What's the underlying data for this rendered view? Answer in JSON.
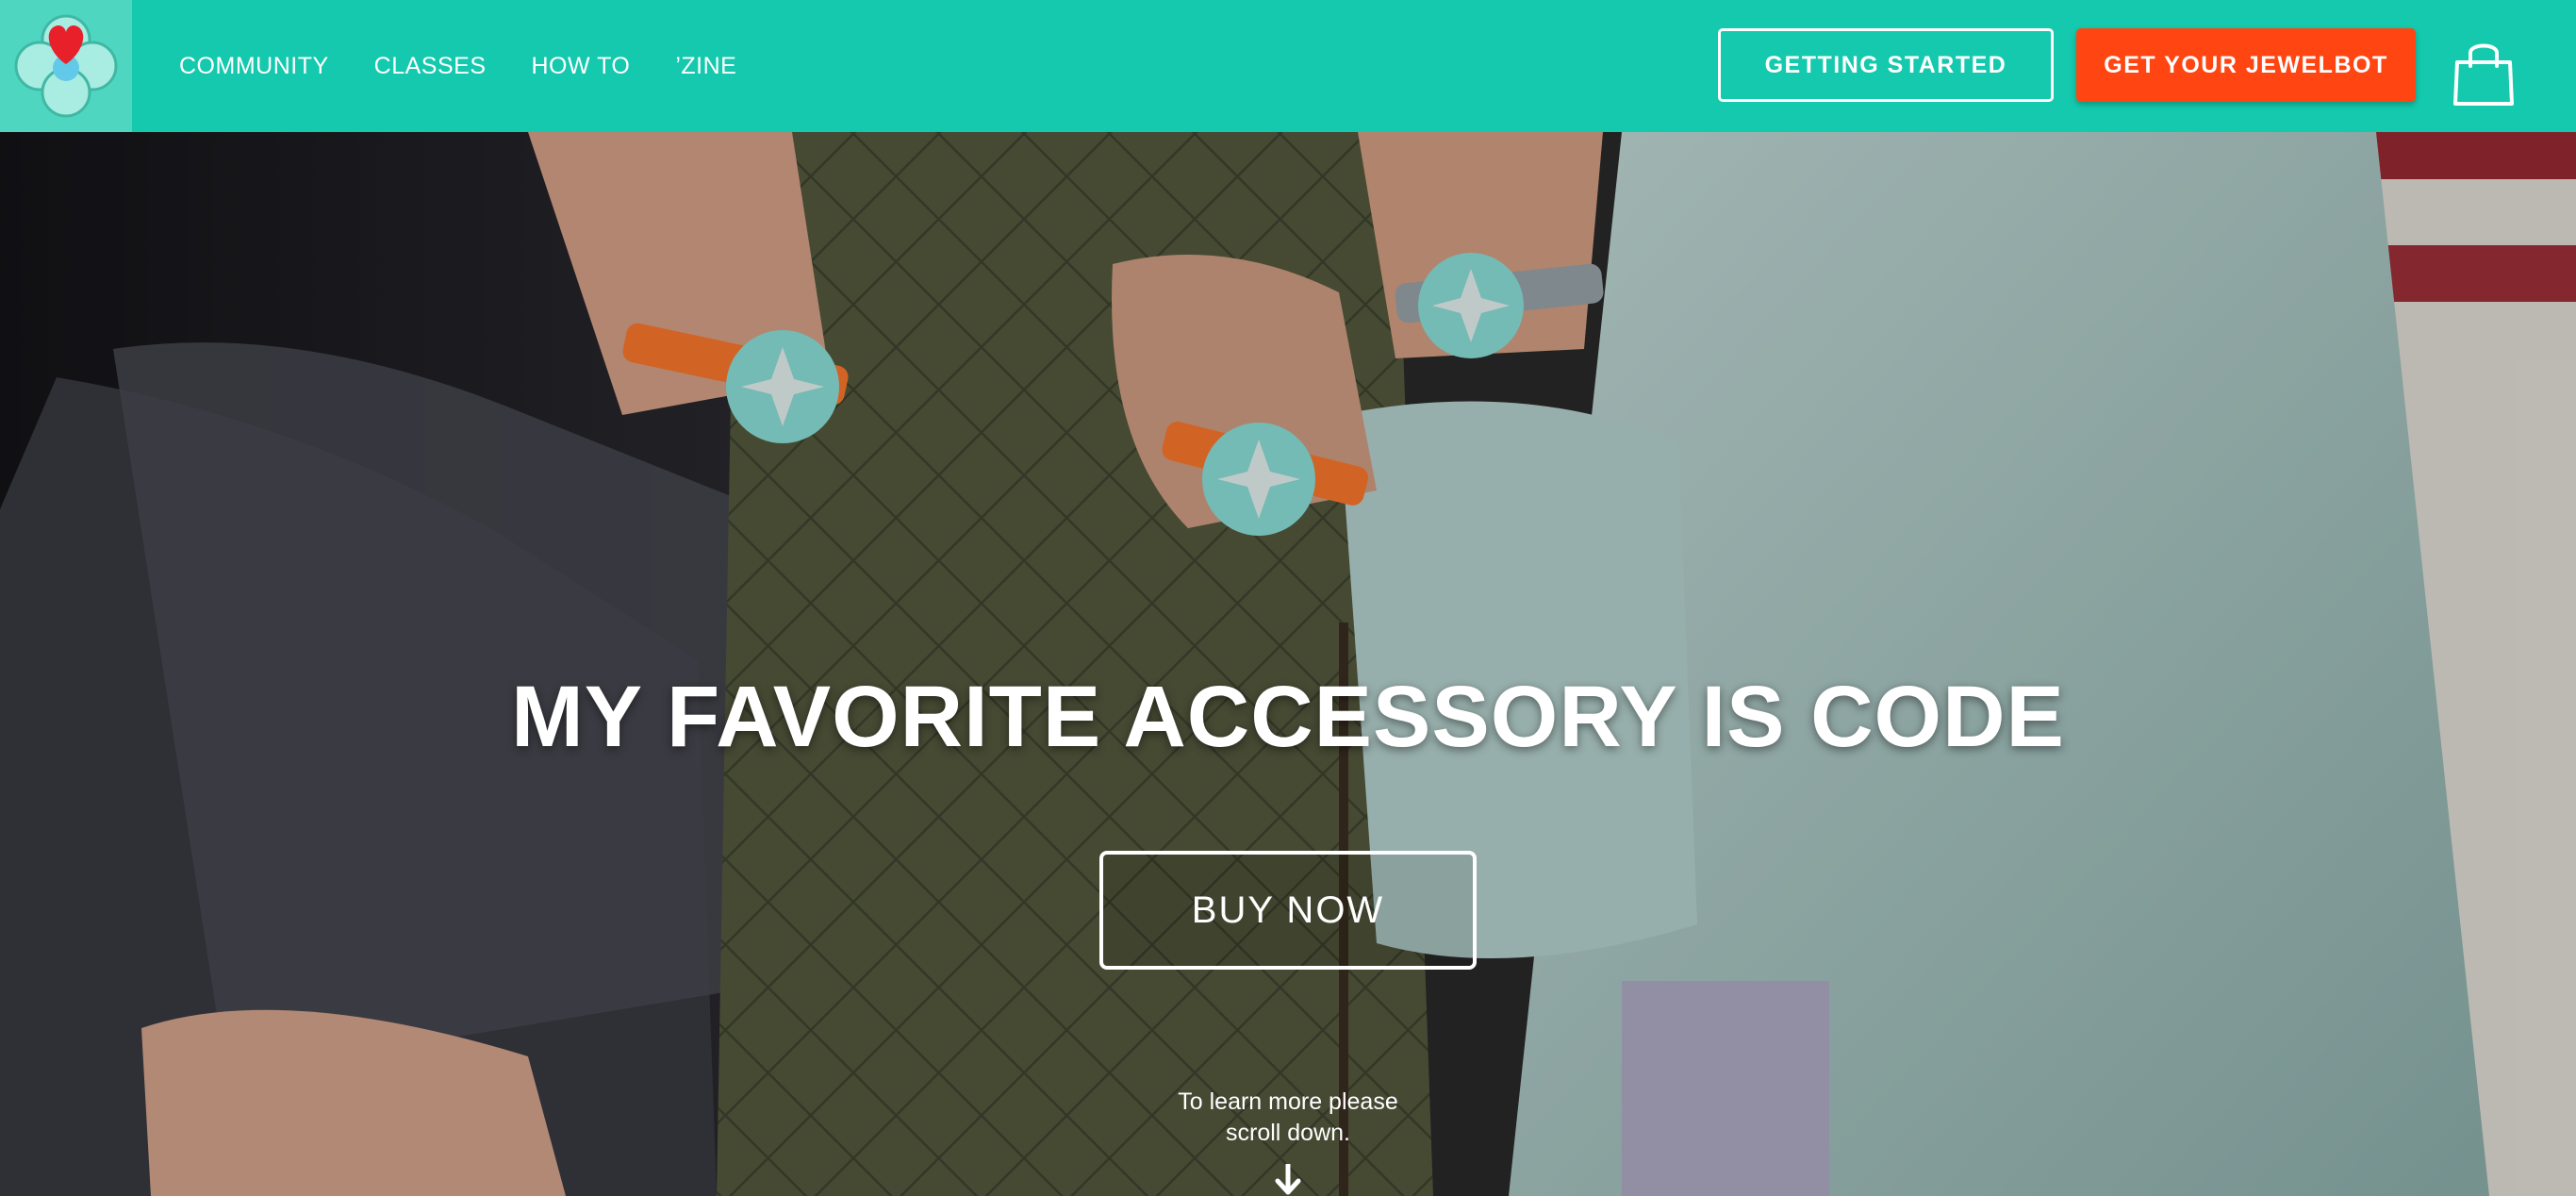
{
  "nav": {
    "links": [
      {
        "label": "COMMUNITY"
      },
      {
        "label": "CLASSES"
      },
      {
        "label": "HOW TO"
      },
      {
        "label": "’ZINE"
      }
    ],
    "getting_started_label": "GETTING STARTED",
    "get_jewelbot_label": "GET YOUR JEWELBOT",
    "cart_icon": "shopping-bag-icon",
    "logo_icon": "heart-clover-logo-icon"
  },
  "hero": {
    "headline": "MY FAVORITE ACCESSORY IS CODE",
    "buy_now_label": "BUY NOW",
    "scroll_hint_line1": "To learn more please",
    "scroll_hint_line2": "scroll down.",
    "scroll_icon": "arrow-down-icon"
  },
  "colors": {
    "nav_bg": "#14c9ad",
    "logo_tile_bg": "#4fd6c1",
    "cta_orange": "#ff4612",
    "text_white": "#ffffff"
  }
}
